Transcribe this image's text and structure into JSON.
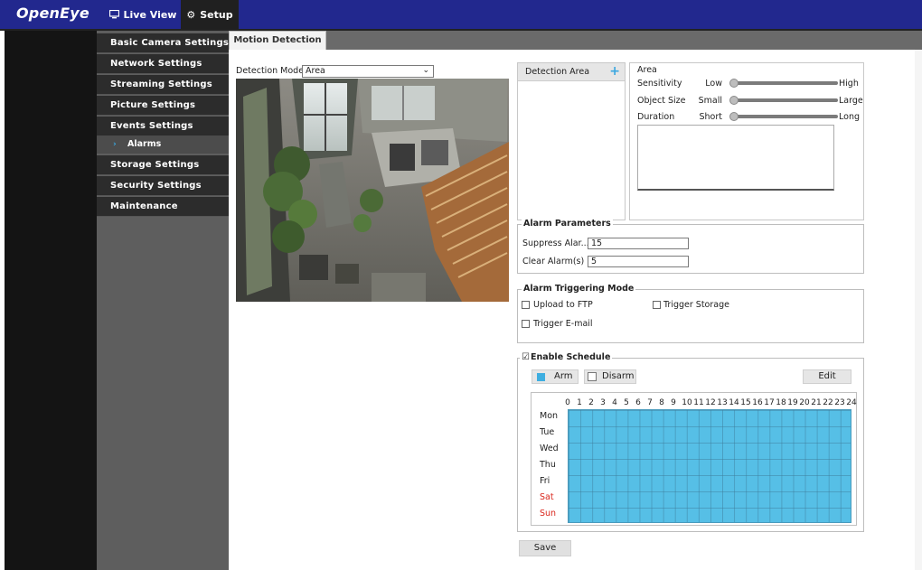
{
  "header": {
    "logo": "OpenEye",
    "nav": [
      {
        "label": "Live View",
        "icon": "monitor-icon"
      },
      {
        "label": "Setup",
        "icon": "gear-icon"
      }
    ]
  },
  "sidebar": {
    "items": [
      {
        "label": "Basic Camera Settings"
      },
      {
        "label": "Network Settings"
      },
      {
        "label": "Streaming Settings"
      },
      {
        "label": "Picture Settings"
      },
      {
        "label": "Events Settings"
      },
      {
        "label": "Alarms",
        "sub": true
      },
      {
        "label": "Storage Settings"
      },
      {
        "label": "Security Settings"
      },
      {
        "label": "Maintenance"
      }
    ]
  },
  "tab": {
    "label": "Motion Detection"
  },
  "detection": {
    "label": "Detection Mode",
    "value": "Area"
  },
  "area_list": {
    "header": "Detection Area"
  },
  "area_params": {
    "title": "Area",
    "rows": [
      {
        "label": "Sensitivity",
        "min": "Low",
        "max": "High",
        "value": 0
      },
      {
        "label": "Object Size",
        "min": "Small",
        "max": "Large",
        "value": 0
      },
      {
        "label": "Duration",
        "min": "Short",
        "max": "Long",
        "value": 0
      }
    ]
  },
  "alarm_params": {
    "title": "Alarm Parameters",
    "suppress_label": "Suppress Alar...",
    "suppress_value": "15",
    "clear_label": "Clear Alarm(s)",
    "clear_value": "5"
  },
  "trigger_mode": {
    "title": "Alarm Triggering Mode",
    "upload_ftp": "Upload to FTP",
    "trigger_storage": "Trigger Storage",
    "trigger_email": "Trigger E-mail"
  },
  "schedule": {
    "title": "Enable Schedule",
    "enabled": true,
    "arm": "Arm",
    "disarm": "Disarm",
    "edit": "Edit",
    "hours": [
      "0",
      "1",
      "2",
      "3",
      "4",
      "5",
      "6",
      "7",
      "8",
      "9",
      "10",
      "11",
      "12",
      "13",
      "14",
      "15",
      "16",
      "17",
      "18",
      "19",
      "20",
      "21",
      "22",
      "23",
      "24"
    ],
    "days": [
      "Mon",
      "Tue",
      "Wed",
      "Thu",
      "Fri",
      "Sat",
      "Sun"
    ],
    "weekend_color": "#d9261c",
    "arm_color": "#56bfe6"
  },
  "save": "Save"
}
